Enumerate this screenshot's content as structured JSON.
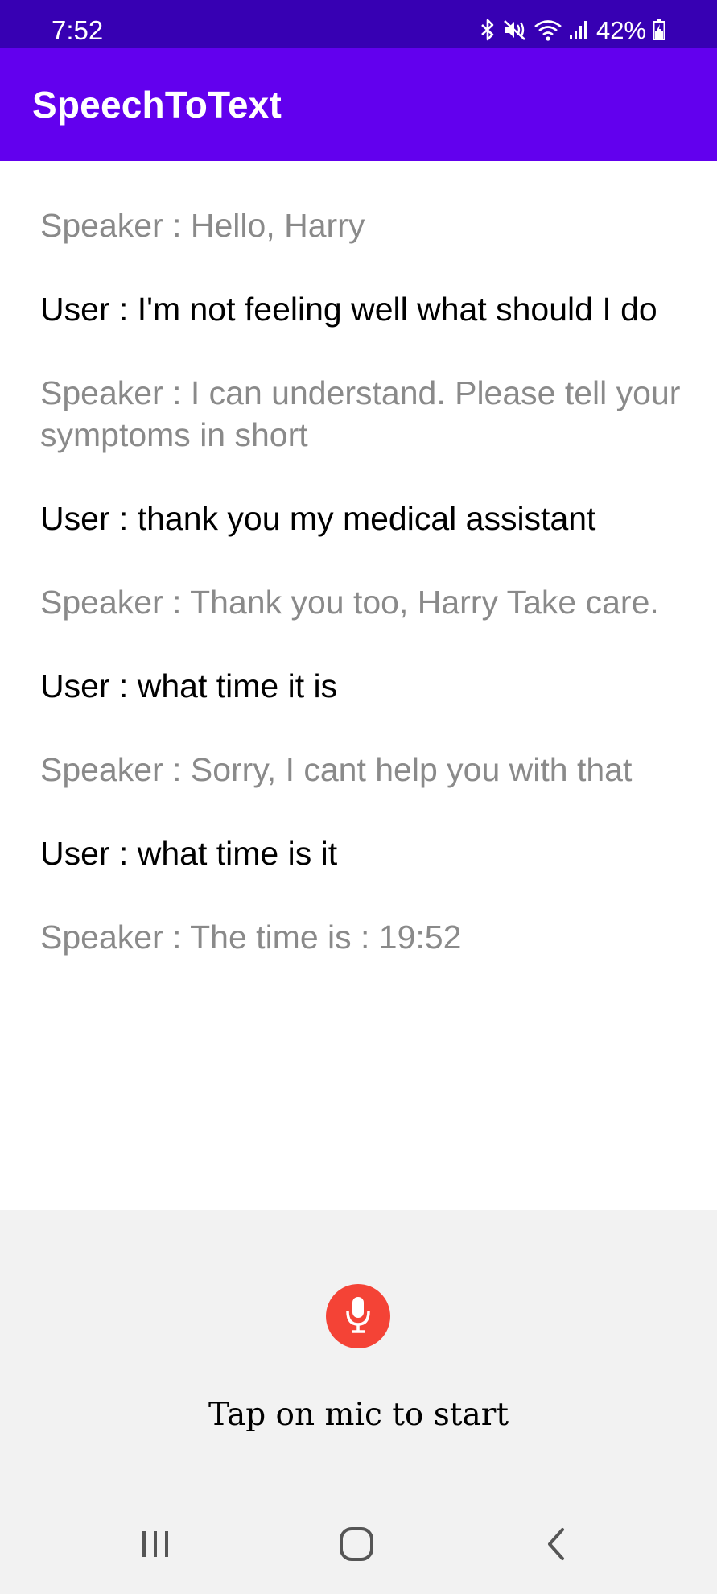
{
  "status_bar": {
    "time": "7:52",
    "battery": "42%",
    "icons": [
      "bluetooth-icon",
      "mute-icon",
      "wifi-icon",
      "signal-icon",
      "battery-icon"
    ]
  },
  "app_bar": {
    "title": "SpeechToText"
  },
  "conversation": [
    {
      "role": "speaker",
      "text": "Speaker : Hello, Harry"
    },
    {
      "role": "user",
      "text": "User : I'm not feeling well what should I do"
    },
    {
      "role": "speaker",
      "text": "Speaker : I can understand. Please tell your symptoms in short"
    },
    {
      "role": "user",
      "text": "User : thank you my medical assistant"
    },
    {
      "role": "speaker",
      "text": "Speaker : Thank you too, Harry Take care."
    },
    {
      "role": "user",
      "text": "User : what time it is"
    },
    {
      "role": "speaker",
      "text": "Speaker : Sorry, I cant help you with that"
    },
    {
      "role": "user",
      "text": "User : what time is it"
    },
    {
      "role": "speaker",
      "text": "Speaker : The time is : 19:52"
    }
  ],
  "mic_panel": {
    "icon": "microphone-icon",
    "hint": "Tap on mic to start"
  },
  "nav_bar": {
    "icons": [
      "recent-apps-icon",
      "home-icon",
      "back-icon"
    ]
  },
  "colors": {
    "status_bar": "#3700b3",
    "app_bar": "#6200ee",
    "mic_button": "#f44336",
    "speaker_text": "#8a8a8a",
    "user_text": "#000000",
    "panel_bg": "#f2f2f2"
  }
}
